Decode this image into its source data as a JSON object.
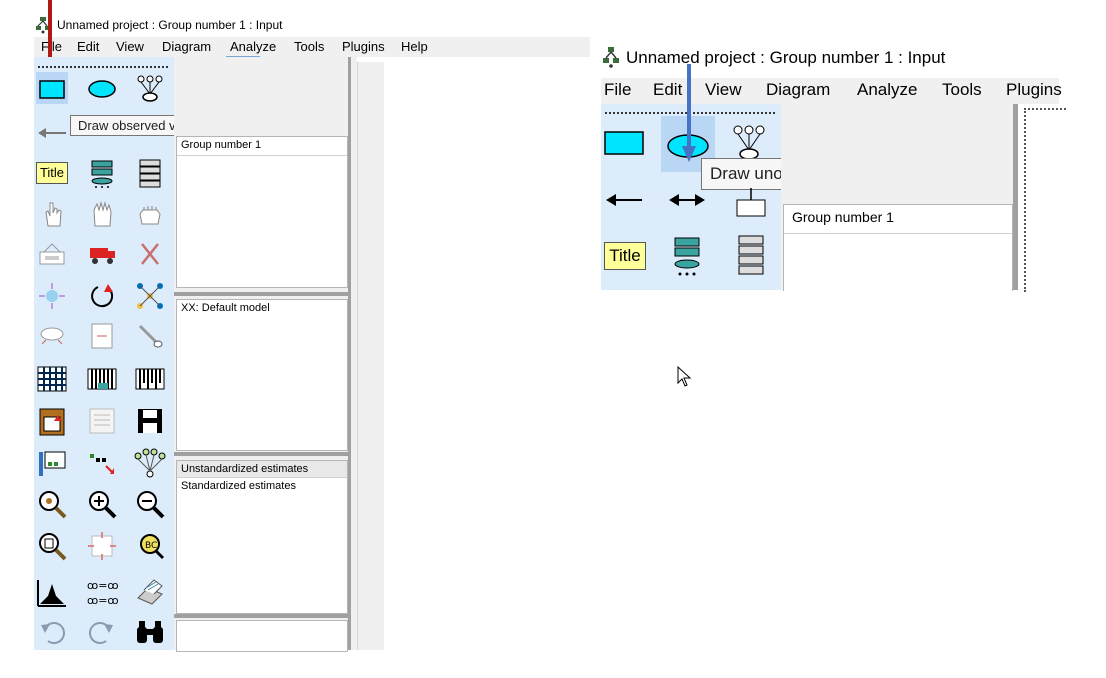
{
  "left_window": {
    "title": "Unnamed project : Group number 1 : Input",
    "menu": [
      "File",
      "Edit",
      "View",
      "Diagram",
      "Analyze",
      "Tools",
      "Plugins",
      "Help"
    ],
    "tooltip": "Draw observed variables",
    "groups_panel_header": "Group number 1",
    "models_panel_item": "XX: Default model",
    "estimates_panel_items": [
      "Unstandardized estimates",
      "Standardized estimates"
    ],
    "title_tool_label": "Title"
  },
  "right_window": {
    "title": "Unnamed project : Group number 1 : Input",
    "menu": [
      "File",
      "Edit",
      "View",
      "Diagram",
      "Analyze",
      "Tools",
      "Plugins"
    ],
    "tooltip": "Draw unobserved variables",
    "groups_panel_header": "Group number 1",
    "title_tool_label": "Title"
  },
  "colors": {
    "red_arrow": "#b01818",
    "blue_arrow": "#4472c4",
    "rect_fill": "#00e5ff",
    "toolbox_bg": "#dcecfb"
  }
}
